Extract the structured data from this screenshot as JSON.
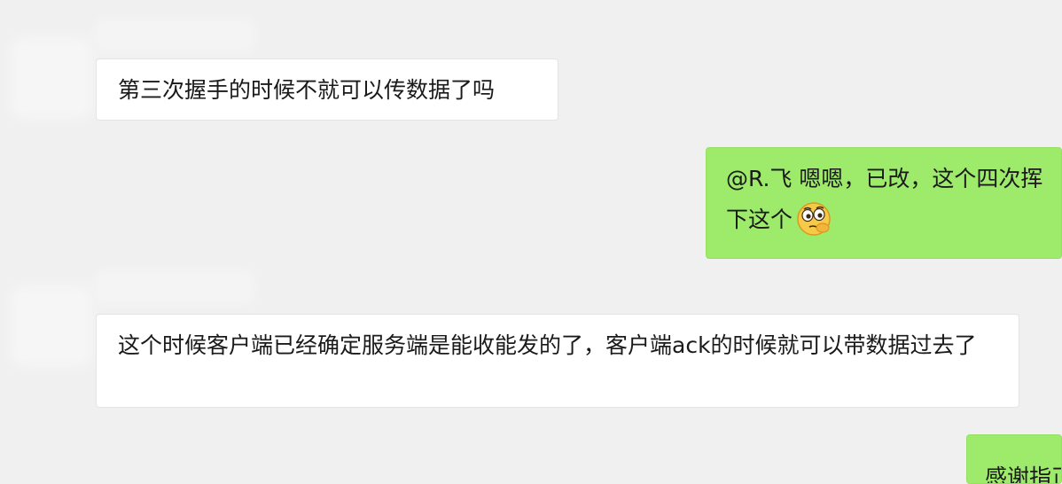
{
  "chat": {
    "messages": [
      {
        "direction": "incoming",
        "sender_name": "",
        "text": "第三次握手的时候不就可以传数据了吗"
      },
      {
        "direction": "outgoing",
        "line1": "@R.飞 嗯嗯，已改，这个四次挥",
        "line2": "下这个",
        "emoji": "thinking-face-emoji"
      },
      {
        "direction": "incoming",
        "sender_name": "",
        "text": "这个时候客户端已经确定服务端是能收能发的了，客户端ack的时候就可以带数据过去了"
      },
      {
        "direction": "outgoing",
        "text": "感谢指正"
      }
    ]
  },
  "colors": {
    "background": "#f0f0f0",
    "incoming_bubble": "#ffffff",
    "outgoing_bubble": "#9eea6a",
    "text": "#1a1a1a"
  }
}
